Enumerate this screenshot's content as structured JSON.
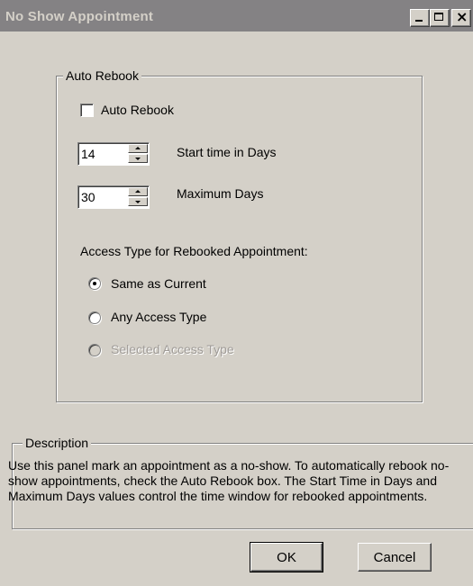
{
  "window": {
    "title": "No Show Appointment",
    "controls": {
      "minimize": "minimize",
      "maximize": "maximize",
      "close": "×"
    }
  },
  "auto_rebook_group": {
    "legend": "Auto Rebook",
    "checkbox_label": "Auto Rebook",
    "checkbox_checked": false,
    "start_time": {
      "value": "14",
      "label": "Start time in Days"
    },
    "max_days": {
      "value": "30",
      "label": "Maximum Days"
    },
    "access_type_heading": "Access Type for Rebooked Appointment:",
    "access_options": [
      {
        "label": "Same as Current",
        "selected": true,
        "enabled": true
      },
      {
        "label": "Any Access Type",
        "selected": false,
        "enabled": true
      },
      {
        "label": "Selected Access Type",
        "selected": false,
        "enabled": false
      }
    ]
  },
  "description": {
    "legend": "Description",
    "text": "Use this panel mark an appointment as a no-show. To automatically rebook no-show appointments, check the Auto Rebook box.  The Start Time in Days and Maximum Days values control the time window for rebooked appointments."
  },
  "buttons": {
    "ok": "OK",
    "cancel": "Cancel"
  },
  "colors": {
    "face": "#d4d0c8",
    "titlebar": "#848284",
    "disabled_text": "#a09c98"
  }
}
